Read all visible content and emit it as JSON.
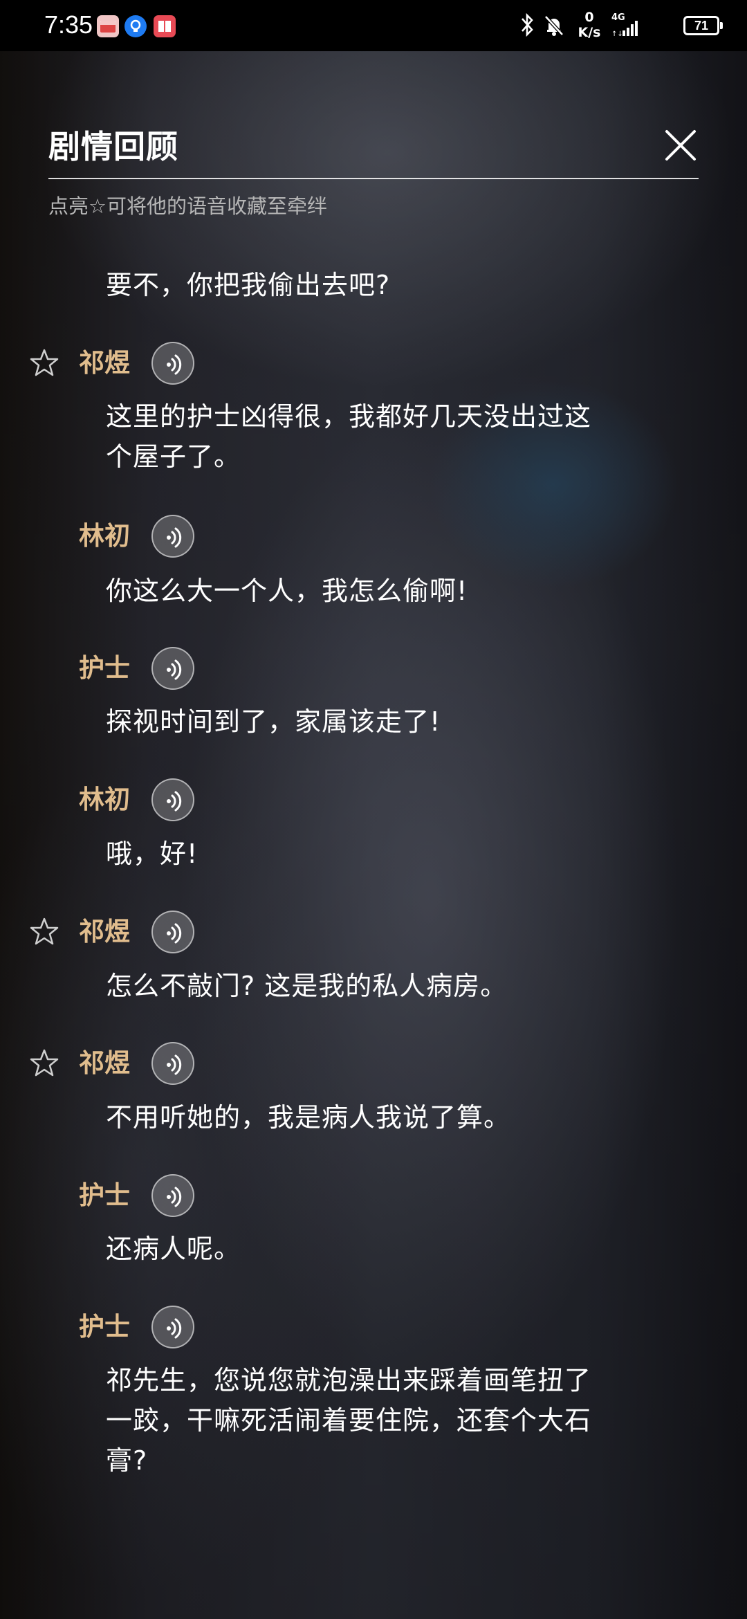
{
  "status_bar": {
    "time": "7:35",
    "net_speed_value": "0",
    "net_speed_unit": "K/s",
    "network": "4G",
    "battery": "71"
  },
  "header": {
    "title": "剧情回顾",
    "hint": "点亮☆可将他的语音收藏至牵绊"
  },
  "dialogue": {
    "intro_line": "要不，你把我偷出去吧?",
    "entries": [
      {
        "speaker": "祁煜",
        "lines": [
          "这里的护士凶得很，我都好几天没出过这",
          "个屋子了。"
        ]
      },
      {
        "speaker": "林初",
        "lines": [
          "你这么大一个人，我怎么偷啊!"
        ]
      },
      {
        "speaker": "护士",
        "lines": [
          "探视时间到了，家属该走了!"
        ]
      },
      {
        "speaker": "林初",
        "lines": [
          "哦，好!"
        ]
      },
      {
        "speaker": "祁煜",
        "lines": [
          "怎么不敲门? 这是我的私人病房。"
        ]
      },
      {
        "speaker": "祁煜",
        "lines": [
          "不用听她的，我是病人我说了算。"
        ]
      },
      {
        "speaker": "护士",
        "lines": [
          "还病人呢。"
        ]
      },
      {
        "speaker": "护士",
        "lines": [
          "祁先生，您说您就泡澡出来踩着画笔扭了",
          "一跤，干嘛死活闹着要住院，还套个大石",
          "膏?"
        ]
      }
    ]
  },
  "colors": {
    "speaker": "#e1bd8d",
    "hint": "#b6b6b6",
    "status_bar_bg": "#000000"
  },
  "icons": {
    "close": "close-icon",
    "star": "star-outline-icon",
    "voice": "voice-play-icon"
  }
}
